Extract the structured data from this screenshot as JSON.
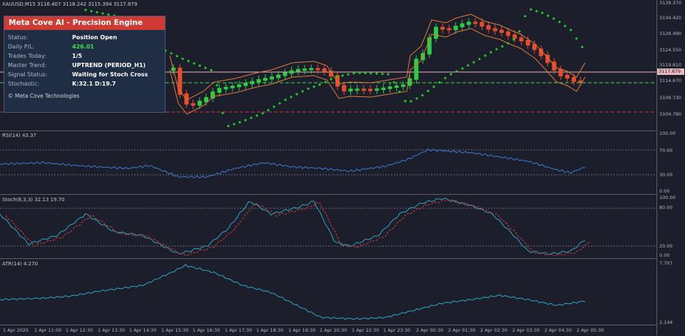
{
  "chart": {
    "symbol_line": "XAUUSD,M15  3116.407 3118.242 3115.394 3117.879",
    "current_price": "3117.879"
  },
  "price_axis": [
    "3139.370",
    "3134.420",
    "3129.490",
    "3124.550",
    "3119.610",
    "3114.670",
    "3109.730",
    "3104.790"
  ],
  "rsi": {
    "label": "RSI(14) 43.37",
    "axis": [
      "100.00",
      "70.00",
      "30.00",
      "0.00"
    ]
  },
  "stoch": {
    "label": "Stoch(8,3,3) 32.13 19.70",
    "axis": [
      "100.00",
      "80.00",
      "20.00",
      "0.00"
    ]
  },
  "atr": {
    "label": "ATR(14) 4.270",
    "axis": [
      "7.707",
      "2.144"
    ]
  },
  "time_axis": [
    "1 Apr 2025",
    "1 Apr 11:00",
    "1 Apr 12:30",
    "1 Apr 13:30",
    "1 Apr 14:30",
    "1 Apr 15:30",
    "1 Apr 16:30",
    "1 Apr 17:30",
    "1 Apr 18:30",
    "1 Apr 19:30",
    "1 Apr 20:30",
    "1 Apr 22:30",
    "1 Apr 23:30",
    "2 Apr 00:30",
    "2 Apr 01:30",
    "2 Apr 02:30",
    "2 Apr 03:30",
    "2 Apr 04:30",
    "2 Apr 05:30"
  ],
  "panel": {
    "title": "Meta Cove AI - Precision Engine",
    "rows": [
      {
        "key": "Status:",
        "value": "Position Open"
      },
      {
        "key": "Daily P/L:",
        "value": "426.01"
      },
      {
        "key": "Trades Today:",
        "value": "1/5"
      },
      {
        "key": "Master Trend:",
        "value": "UPTREND (PERIOD_H1)"
      },
      {
        "key": "Signal Status:",
        "value": "Waiting for Stoch Cross"
      },
      {
        "key": "Stochastic:",
        "value": "K:32.1 D:19.7"
      }
    ],
    "footer": "© Meta Cove Technologies"
  },
  "colors": {
    "bull": "#2ecc40",
    "bear": "#e84c2a",
    "sar": "#22cc22",
    "rsi_line": "#3d7bd8",
    "stoch_k": "#2aa9c9",
    "stoch_d": "#e03a3a",
    "atr_line": "#2aa9c9",
    "header_red": "#cf3b32",
    "pl_green": "#3ddc4a"
  }
}
